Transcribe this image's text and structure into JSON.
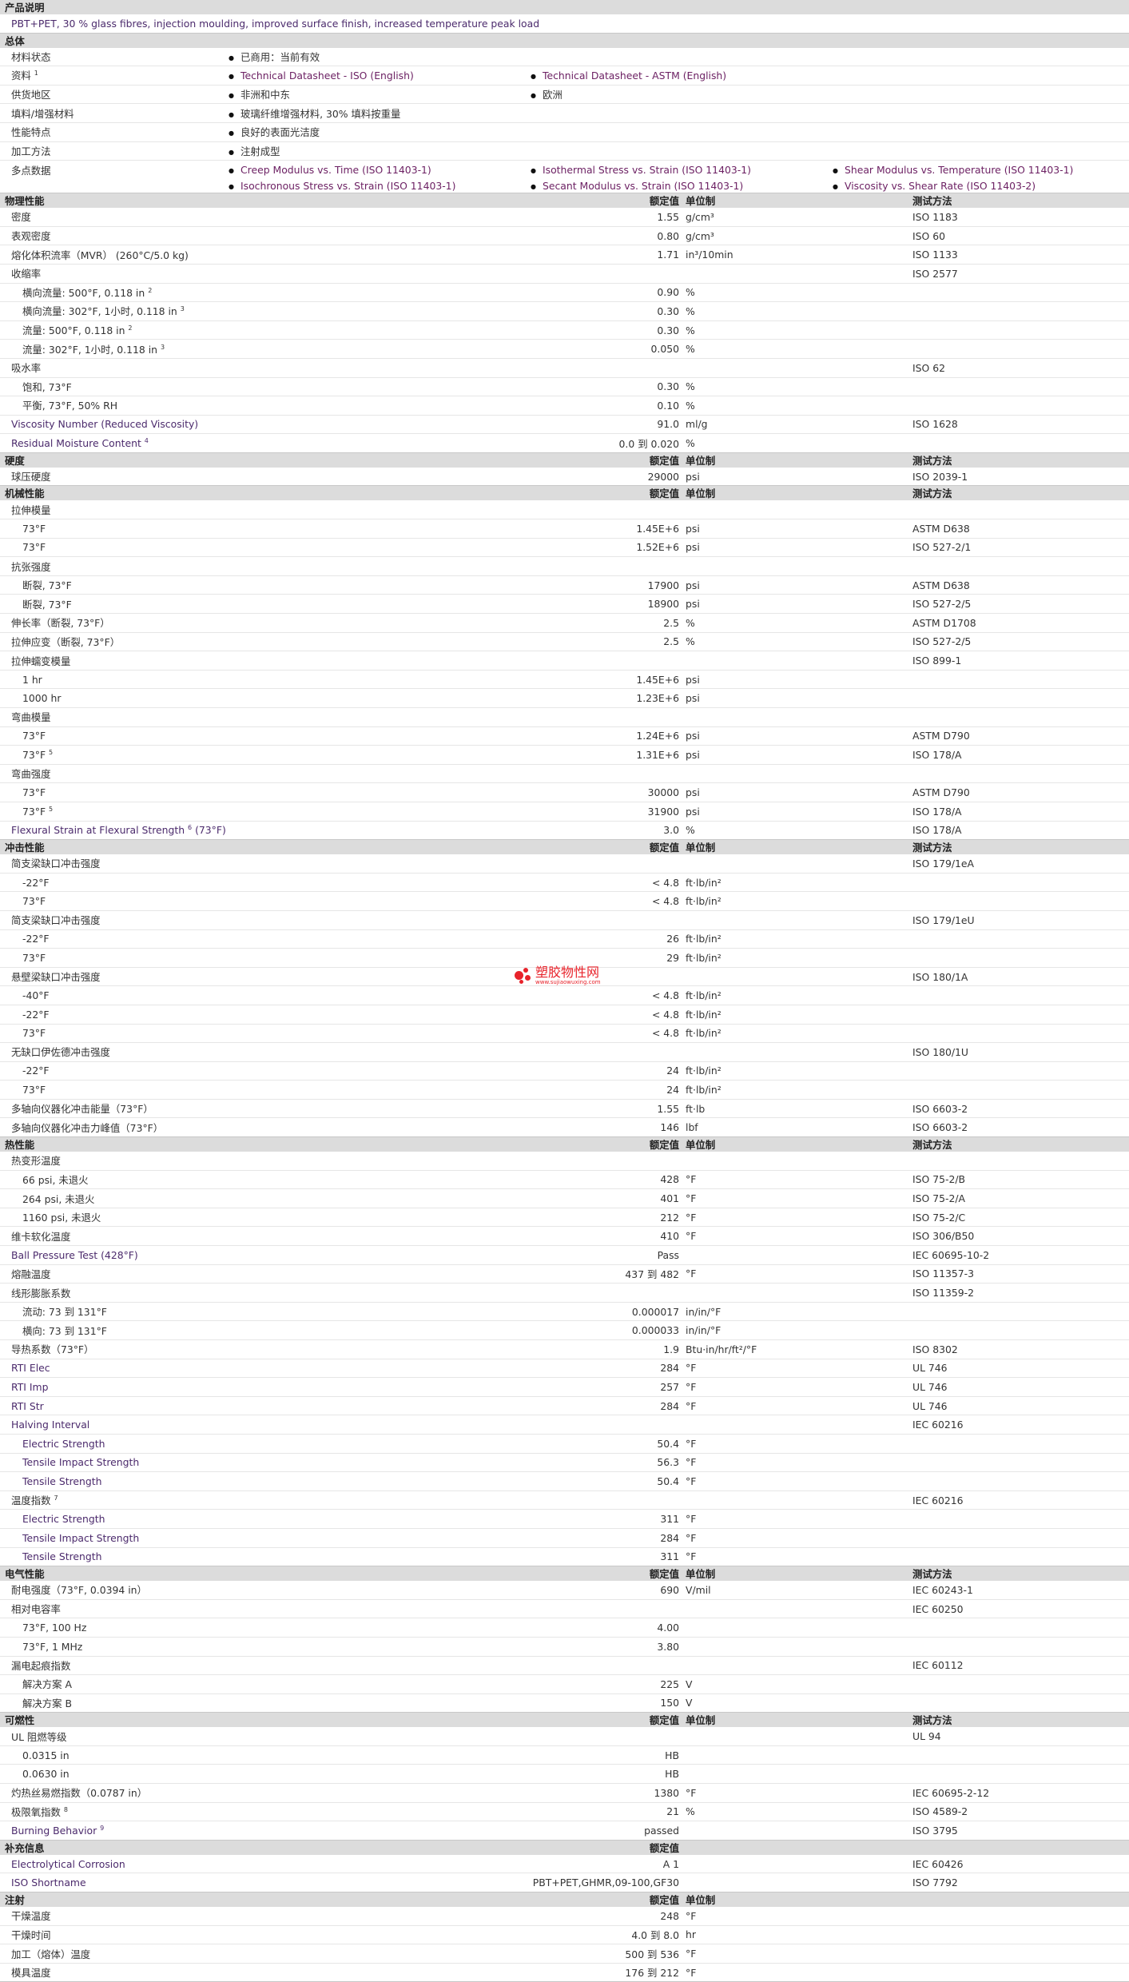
{
  "col_headers": {
    "nominal": "额定值",
    "unit": "单位制",
    "method": "测试方法"
  },
  "product_description": {
    "title": "产品说明",
    "text": "PBT+PET, 30 % glass fibres, injection moulding, improved surface finish, increased temperature peak load"
  },
  "general": {
    "title": "总体",
    "material_status": {
      "label": "材料状态",
      "value": "已商用：当前有效"
    },
    "literature": {
      "label": "资料",
      "note": "1",
      "items": [
        "Technical Datasheet - ISO (English)",
        "Technical Datasheet - ASTM (English)"
      ]
    },
    "availability": {
      "label": "供货地区",
      "items": [
        "非洲和中东",
        "欧洲"
      ]
    },
    "filler": {
      "label": "填料/增强材料",
      "value": "玻璃纤维增强材料, 30% 填料按重量"
    },
    "features": {
      "label": "性能特点",
      "value": "良好的表面光洁度"
    },
    "processing": {
      "label": "加工方法",
      "value": "注射成型"
    },
    "multipoint": {
      "label": "多点数据",
      "items": [
        "Creep Modulus vs. Time (ISO 11403-1)",
        "Isothermal Stress vs. Strain (ISO 11403-1)",
        "Shear Modulus vs. Temperature (ISO 11403-1)",
        "Isochronous Stress vs. Strain (ISO 11403-1)",
        "Secant Modulus vs. Strain (ISO 11403-1)",
        "Viscosity vs. Shear Rate (ISO 11403-2)"
      ]
    }
  },
  "physical": {
    "title": "物理性能",
    "rows": [
      {
        "label": "密度",
        "value": "1.55",
        "unit": "g/cm³",
        "method": "ISO 1183"
      },
      {
        "label": "表观密度",
        "value": "0.80",
        "unit": "g/cm³",
        "method": "ISO 60"
      },
      {
        "label": "熔化体积流率（MVR） (260°C/5.0 kg)",
        "value": "1.71",
        "unit": "in³/10min",
        "method": "ISO 1133"
      },
      {
        "label": "收缩率",
        "value": "",
        "unit": "",
        "method": "ISO 2577"
      },
      {
        "label": "横向流量: 500°F, 0.118 in",
        "note": "2",
        "value": "0.90",
        "unit": "%",
        "method": "",
        "sub": true
      },
      {
        "label": "横向流量: 302°F, 1小时, 0.118 in",
        "note": "3",
        "value": "0.30",
        "unit": "%",
        "method": "",
        "sub": true
      },
      {
        "label": "流量: 500°F, 0.118 in",
        "note": "2",
        "value": "0.30",
        "unit": "%",
        "method": "",
        "sub": true
      },
      {
        "label": "流量: 302°F, 1小时, 0.118 in",
        "note": "3",
        "value": "0.050",
        "unit": "%",
        "method": "",
        "sub": true
      },
      {
        "label": "吸水率",
        "value": "",
        "unit": "",
        "method": "ISO 62"
      },
      {
        "label": "饱和, 73°F",
        "value": "0.30",
        "unit": "%",
        "method": "",
        "sub": true
      },
      {
        "label": "平衡, 73°F, 50% RH",
        "value": "0.10",
        "unit": "%",
        "method": "",
        "sub": true
      },
      {
        "label": "Viscosity Number (Reduced Viscosity)",
        "value": "91.0",
        "unit": "ml/g",
        "method": "ISO 1628",
        "purple": true
      },
      {
        "label": "Residual Moisture Content",
        "note": "4",
        "value": "0.0 到  0.020",
        "unit": "%",
        "method": "",
        "purple": true
      }
    ]
  },
  "hardness": {
    "title": "硬度",
    "rows": [
      {
        "label": "球压硬度",
        "value": "29000",
        "unit": "psi",
        "method": "ISO 2039-1"
      }
    ]
  },
  "mechanical": {
    "title": "机械性能",
    "rows": [
      {
        "label": "拉伸模量",
        "value": "",
        "unit": "",
        "method": ""
      },
      {
        "label": "73°F",
        "value": "1.45E+6",
        "unit": "psi",
        "method": "ASTM D638",
        "sub": true
      },
      {
        "label": "73°F",
        "value": "1.52E+6",
        "unit": "psi",
        "method": "ISO 527-2/1",
        "sub": true
      },
      {
        "label": "抗张强度",
        "value": "",
        "unit": "",
        "method": ""
      },
      {
        "label": "断裂, 73°F",
        "value": "17900",
        "unit": "psi",
        "method": "ASTM D638",
        "sub": true
      },
      {
        "label": "断裂, 73°F",
        "value": "18900",
        "unit": "psi",
        "method": "ISO 527-2/5",
        "sub": true
      },
      {
        "label": "伸长率（断裂, 73°F）",
        "value": "2.5",
        "unit": "%",
        "method": "ASTM D1708"
      },
      {
        "label": "拉伸应变（断裂, 73°F）",
        "value": "2.5",
        "unit": "%",
        "method": "ISO 527-2/5"
      },
      {
        "label": "拉伸蠕变模量",
        "value": "",
        "unit": "",
        "method": "ISO 899-1"
      },
      {
        "label": "1 hr",
        "value": "1.45E+6",
        "unit": "psi",
        "method": "",
        "sub": true
      },
      {
        "label": "1000 hr",
        "value": "1.23E+6",
        "unit": "psi",
        "method": "",
        "sub": true
      },
      {
        "label": "弯曲模量",
        "value": "",
        "unit": "",
        "method": ""
      },
      {
        "label": "73°F",
        "value": "1.24E+6",
        "unit": "psi",
        "method": "ASTM D790",
        "sub": true
      },
      {
        "label": "73°F",
        "note": "5",
        "value": "1.31E+6",
        "unit": "psi",
        "method": "ISO 178/A",
        "sub": true
      },
      {
        "label": "弯曲强度",
        "value": "",
        "unit": "",
        "method": ""
      },
      {
        "label": "73°F",
        "value": "30000",
        "unit": "psi",
        "method": "ASTM D790",
        "sub": true
      },
      {
        "label": "73°F",
        "note": "5",
        "value": "31900",
        "unit": "psi",
        "method": "ISO 178/A",
        "sub": true
      },
      {
        "label": "Flexural Strain at Flexural Strength",
        "note": "6",
        "suffix": " (73°F)",
        "value": "3.0",
        "unit": "%",
        "method": "ISO 178/A",
        "purple": true
      }
    ]
  },
  "impact": {
    "title": "冲击性能",
    "rows": [
      {
        "label": "简支梁缺口冲击强度",
        "value": "",
        "unit": "",
        "method": "ISO 179/1eA"
      },
      {
        "label": "-22°F",
        "value": "< 4.8",
        "unit": "ft·lb/in²",
        "method": "",
        "sub": true
      },
      {
        "label": "73°F",
        "value": "< 4.8",
        "unit": "ft·lb/in²",
        "method": "",
        "sub": true
      },
      {
        "label": "简支梁缺口冲击强度",
        "value": "",
        "unit": "",
        "method": "ISO 179/1eU"
      },
      {
        "label": "-22°F",
        "value": "26",
        "unit": "ft·lb/in²",
        "method": "",
        "sub": true
      },
      {
        "label": "73°F",
        "value": "29",
        "unit": "ft·lb/in²",
        "method": "",
        "sub": true
      },
      {
        "label": "悬壁梁缺口冲击强度",
        "value": "",
        "unit": "",
        "method": "ISO 180/1A"
      },
      {
        "label": "-40°F",
        "value": "< 4.8",
        "unit": "ft·lb/in²",
        "method": "",
        "sub": true
      },
      {
        "label": "-22°F",
        "value": "< 4.8",
        "unit": "ft·lb/in²",
        "method": "",
        "sub": true
      },
      {
        "label": "73°F",
        "value": "< 4.8",
        "unit": "ft·lb/in²",
        "method": "",
        "sub": true
      },
      {
        "label": "无缺口伊佐德冲击强度",
        "value": "",
        "unit": "",
        "method": "ISO 180/1U"
      },
      {
        "label": "-22°F",
        "value": "24",
        "unit": "ft·lb/in²",
        "method": "",
        "sub": true
      },
      {
        "label": "73°F",
        "value": "24",
        "unit": "ft·lb/in²",
        "method": "",
        "sub": true
      },
      {
        "label": "多轴向仪器化冲击能量（73°F）",
        "value": "1.55",
        "unit": "ft·lb",
        "method": "ISO 6603-2"
      },
      {
        "label": "多轴向仪器化冲击力峰值（73°F）",
        "value": "146",
        "unit": "lbf",
        "method": "ISO 6603-2"
      }
    ]
  },
  "thermal": {
    "title": "热性能",
    "rows": [
      {
        "label": "热变形温度",
        "value": "",
        "unit": "",
        "method": ""
      },
      {
        "label": "66 psi, 未退火",
        "value": "428",
        "unit": "°F",
        "method": "ISO 75-2/B",
        "sub": true
      },
      {
        "label": "264 psi, 未退火",
        "value": "401",
        "unit": "°F",
        "method": "ISO 75-2/A",
        "sub": true
      },
      {
        "label": "1160 psi, 未退火",
        "value": "212",
        "unit": "°F",
        "method": "ISO 75-2/C",
        "sub": true
      },
      {
        "label": "维卡软化温度",
        "value": "410",
        "unit": "°F",
        "method": "ISO 306/B50"
      },
      {
        "label": "Ball Pressure Test (428°F)",
        "value": "Pass",
        "unit": "",
        "method": "IEC 60695-10-2",
        "purple": true
      },
      {
        "label": "熔融温度",
        "value": "437 到  482",
        "unit": "°F",
        "method": "ISO 11357-3"
      },
      {
        "label": "线形膨胀系数",
        "value": "",
        "unit": "",
        "method": "ISO 11359-2"
      },
      {
        "label": "流动: 73 到  131°F",
        "value": "0.000017",
        "unit": "in/in/°F",
        "method": "",
        "sub": true
      },
      {
        "label": "横向: 73 到  131°F",
        "value": "0.000033",
        "unit": "in/in/°F",
        "method": "",
        "sub": true
      },
      {
        "label": "导热系数（73°F）",
        "value": "1.9",
        "unit": "Btu·in/hr/ft²/°F",
        "method": "ISO 8302"
      },
      {
        "label": "RTI Elec",
        "value": "284",
        "unit": "°F",
        "method": "UL 746",
        "purple": true
      },
      {
        "label": "RTI Imp",
        "value": "257",
        "unit": "°F",
        "method": "UL 746",
        "purple": true
      },
      {
        "label": "RTI Str",
        "value": "284",
        "unit": "°F",
        "method": "UL 746",
        "purple": true
      },
      {
        "label": "Halving Interval",
        "value": "",
        "unit": "",
        "method": "IEC 60216",
        "purple": true
      },
      {
        "label": "Electric Strength",
        "value": "50.4",
        "unit": "°F",
        "method": "",
        "sub": true,
        "purple": true
      },
      {
        "label": "Tensile Impact Strength",
        "value": "56.3",
        "unit": "°F",
        "method": "",
        "sub": true,
        "purple": true
      },
      {
        "label": "Tensile Strength",
        "value": "50.4",
        "unit": "°F",
        "method": "",
        "sub": true,
        "purple": true
      },
      {
        "label": "温度指数",
        "note": "7",
        "value": "",
        "unit": "",
        "method": "IEC 60216"
      },
      {
        "label": "Electric Strength",
        "value": "311",
        "unit": "°F",
        "method": "",
        "sub": true,
        "purple": true
      },
      {
        "label": "Tensile Impact Strength",
        "value": "284",
        "unit": "°F",
        "method": "",
        "sub": true,
        "purple": true
      },
      {
        "label": "Tensile Strength",
        "value": "311",
        "unit": "°F",
        "method": "",
        "sub": true,
        "purple": true
      }
    ]
  },
  "electrical": {
    "title": "电气性能",
    "rows": [
      {
        "label": "耐电强度（73°F, 0.0394 in）",
        "value": "690",
        "unit": "V/mil",
        "method": "IEC 60243-1"
      },
      {
        "label": "相对电容率",
        "value": "",
        "unit": "",
        "method": "IEC 60250"
      },
      {
        "label": "73°F, 100 Hz",
        "value": "4.00",
        "unit": "",
        "method": "",
        "sub": true
      },
      {
        "label": "73°F, 1 MHz",
        "value": "3.80",
        "unit": "",
        "method": "",
        "sub": true
      },
      {
        "label": "漏电起痕指数",
        "value": "",
        "unit": "",
        "method": "IEC 60112"
      },
      {
        "label": "解决方案 A",
        "value": "225",
        "unit": "V",
        "method": "",
        "sub": true
      },
      {
        "label": "解决方案 B",
        "value": "150",
        "unit": "V",
        "method": "",
        "sub": true
      }
    ]
  },
  "flammability": {
    "title": "可燃性",
    "rows": [
      {
        "label": "UL 阻燃等级",
        "value": "",
        "unit": "",
        "method": "UL 94"
      },
      {
        "label": "0.0315 in",
        "value": "HB",
        "unit": "",
        "method": "",
        "sub": true,
        "center": true
      },
      {
        "label": "0.0630 in",
        "value": "HB",
        "unit": "",
        "method": "",
        "sub": true,
        "center": true
      },
      {
        "label": "灼热丝易燃指数（0.0787 in）",
        "value": "1380",
        "unit": "°F",
        "method": "IEC 60695-2-12"
      },
      {
        "label": "极限氧指数",
        "note": "8",
        "value": "21",
        "unit": "%",
        "method": "ISO 4589-2"
      },
      {
        "label": "Burning Behavior",
        "note": "9",
        "value": "passed",
        "unit": "",
        "method": "ISO 3795",
        "purple": true,
        "center": true
      }
    ]
  },
  "supplemental": {
    "title": "补充信息",
    "rows": [
      {
        "label": "Electrolytical Corrosion",
        "value": "A 1",
        "unit": "",
        "method": "IEC 60426",
        "purple": true,
        "center": true
      },
      {
        "label": "ISO Shortname",
        "value": "PBT+PET,GHMR,09-100,GF30",
        "unit": "",
        "method": "ISO 7792",
        "purple": true,
        "center": true
      }
    ]
  },
  "injection": {
    "title": "注射",
    "rows": [
      {
        "label": "干燥温度",
        "value": "248",
        "unit": "°F",
        "method": ""
      },
      {
        "label": "干燥时间",
        "value": "4.0 到  8.0",
        "unit": "hr",
        "method": ""
      },
      {
        "label": "加工（熔体）温度",
        "value": "500 到  536",
        "unit": "°F",
        "method": ""
      },
      {
        "label": "模具温度",
        "value": "176 到  212",
        "unit": "°F",
        "method": ""
      }
    ]
  },
  "watermark": {
    "name": "塑胶物性网",
    "url": "www.sujiaowuxing.com"
  },
  "colors": {
    "section_bg": "#dcdcdc",
    "link": "#6b1f62",
    "label_purple": "#4b2a6c",
    "watermark": "#e8232b"
  }
}
